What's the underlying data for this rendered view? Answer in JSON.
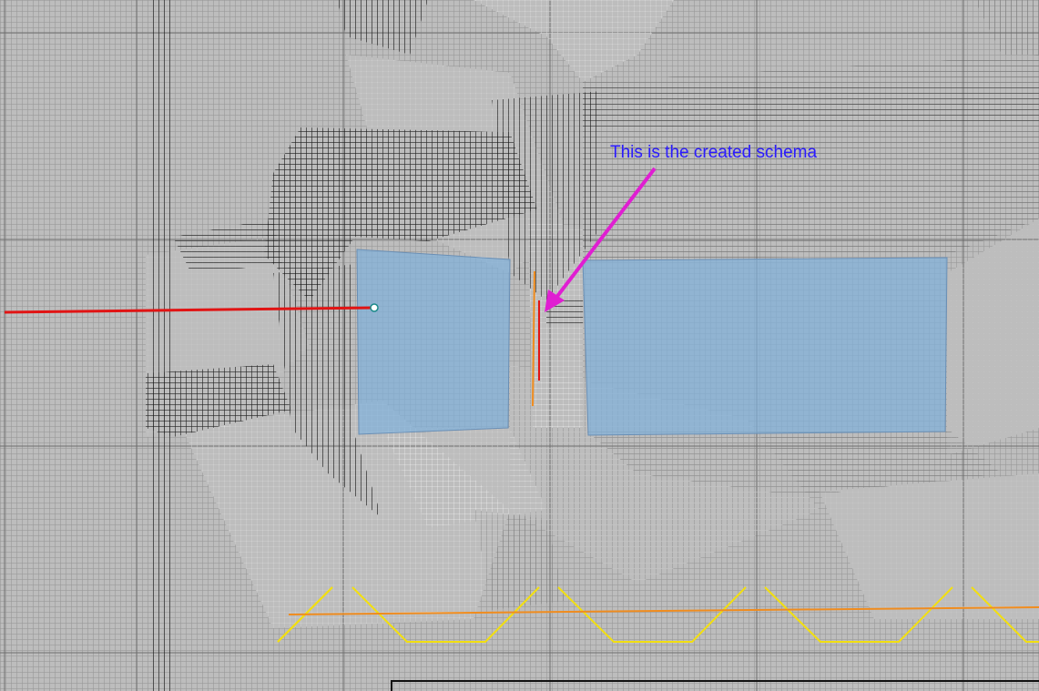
{
  "annotation": {
    "text": "This is the created schema"
  },
  "colors": {
    "background": "#bdbdbd",
    "grid_minor": "#9a9a9a",
    "grid_major": "#6f6f6f",
    "hatch_dark": "#111111",
    "hatch_light": "#e8e8e8",
    "schema_fill": "#7fb0dc",
    "schema_stroke": "#6a8fb5",
    "red_line": "#e11414",
    "arrow": "#e01ed2",
    "orange_line": "#f08c1e",
    "yellow_line": "#f2df10",
    "annotation_text": "#2b1bff"
  },
  "icons": {
    "anchor_point": "anchor-point-icon",
    "arrow": "annotation-arrow-icon"
  }
}
